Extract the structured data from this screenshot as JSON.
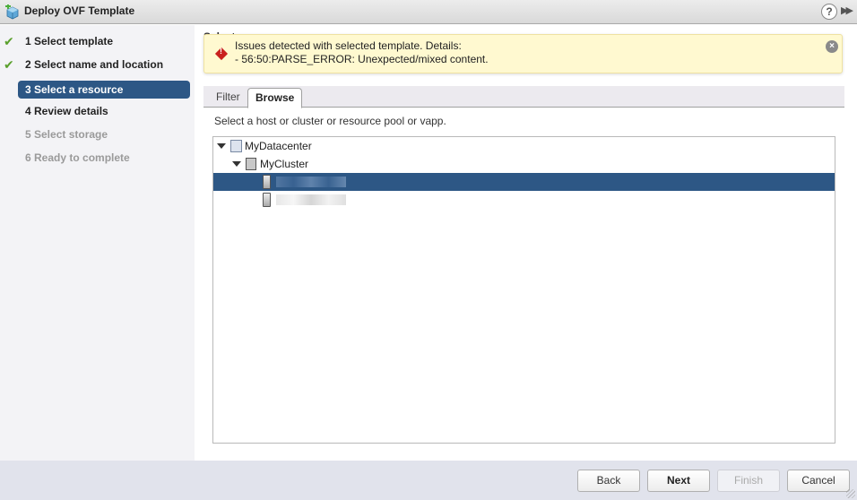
{
  "window": {
    "title": "Deploy OVF Template",
    "help_icon": "?",
    "expand_icon": "▶▶"
  },
  "steps": [
    {
      "number": "1",
      "label": "Select template",
      "state": "completed"
    },
    {
      "number": "2",
      "label": "Select name and location",
      "state": "completed"
    },
    {
      "number": "3",
      "label": "Select a resource",
      "state": "active"
    },
    {
      "number": "4",
      "label": "Review details",
      "state": "enabled"
    },
    {
      "number": "5",
      "label": "Select storage",
      "state": "disabled"
    },
    {
      "number": "6",
      "label": "Ready to complete",
      "state": "disabled"
    }
  ],
  "step_labels": {
    "s1": "1  Select template",
    "s2": "2  Select name and location",
    "s3": "3  Select a resource",
    "s4": "4  Review details",
    "s5": "5  Select storage",
    "s6": "6  Ready to complete"
  },
  "check_glyph": "✔",
  "main": {
    "section_title": "Select a resource",
    "alert": {
      "line1": "Issues detected with selected template. Details:",
      "line2": "- 56:50:PARSE_ERROR: Unexpected/mixed content.",
      "error_glyph": "!",
      "close_glyph": "×"
    },
    "tabs": [
      {
        "label": "Filter",
        "active": false
      },
      {
        "label": "Browse",
        "active": true
      }
    ],
    "instruction": "Select a host or cluster or resource pool or vapp.",
    "tree": {
      "datacenter": "MyDatacenter",
      "cluster": "MyCluster",
      "hosts": [
        {
          "label": "[redacted]",
          "selected": true
        },
        {
          "label": "[redacted]",
          "selected": false
        }
      ]
    }
  },
  "footer": {
    "back": "Back",
    "next": "Next",
    "finish": "Finish",
    "cancel": "Cancel"
  },
  "colors": {
    "accent": "#2d5785",
    "alert_bg": "#fff9d0",
    "error": "#c9211e",
    "check": "#5aa02c"
  }
}
